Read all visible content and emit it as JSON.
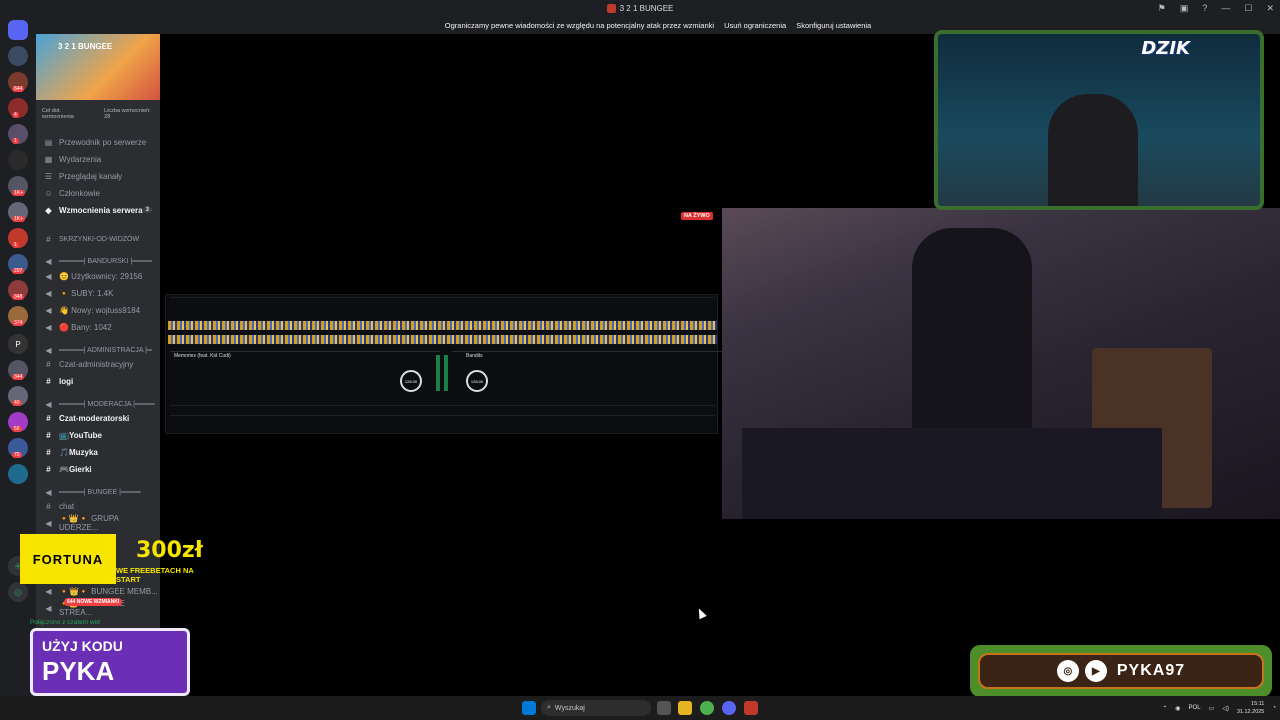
{
  "window": {
    "title": "3 2 1 BUNGEE"
  },
  "banner": {
    "message": "Ograniczamy pewne wiadomości ze względu na potencjalny atak przez wzmianki",
    "action1": "Usuń ograniczenia",
    "action2": "Skonfiguruj ustawienia"
  },
  "server": {
    "name": "3 2 1 BUNGEE",
    "boost_goal_label": "Cel dot. wzmocnienia",
    "boost_count_label": "Liczba wzmocnień: 28"
  },
  "server_badges": [
    "644",
    "4",
    "1",
    "1K+",
    "1K+",
    "1",
    "297",
    "348",
    "374",
    "344",
    "40",
    "56",
    "70"
  ],
  "sidebar": {
    "nav": [
      {
        "icon": "book-icon",
        "label": "Przewodnik po serwerze"
      },
      {
        "icon": "calendar-icon",
        "label": "Wydarzenia"
      },
      {
        "icon": "browse-icon",
        "label": "Przeglądaj kanały"
      },
      {
        "icon": "members-icon",
        "label": "Członkowie"
      },
      {
        "icon": "boost-icon",
        "label": "Wzmocnienia serwera",
        "count": "3"
      }
    ],
    "channels": [
      {
        "icon": "#",
        "label": "SKRZYNKI-OD-WIDZÓW",
        "type": "category"
      },
      {
        "icon": "voice",
        "label": "═════| BANDURSKI |════"
      },
      {
        "icon": "voice",
        "label": "😊 Użytkownicy: 29156"
      },
      {
        "icon": "voice",
        "label": "🔸 SUBY: 1.4K"
      },
      {
        "icon": "voice",
        "label": "👋 Nowy: wojtuss9184"
      },
      {
        "icon": "voice",
        "label": "🔴 Bany: 1042"
      },
      {
        "icon": "voice",
        "label": "═════| ADMINISTRACJA |═"
      },
      {
        "icon": "#",
        "label": "Czat-administracyjny"
      },
      {
        "icon": "#",
        "label": "logi",
        "bold": true
      },
      {
        "icon": "voice",
        "label": "═════| MODERACJA |════"
      },
      {
        "icon": "#",
        "label": "Czat-moderatorski",
        "bold": true
      },
      {
        "icon": "#",
        "label": "📺YouTube",
        "bold": true
      },
      {
        "icon": "#",
        "label": "🎵Muzyka",
        "bold": true
      },
      {
        "icon": "#",
        "label": "🎮Gierki",
        "bold": true
      },
      {
        "icon": "voice",
        "label": "═════| BUNGEE |════"
      },
      {
        "icon": "#",
        "label": "chat"
      },
      {
        "icon": "voice",
        "label": "🔸👑🔸 GRUPA UDERZE..."
      }
    ],
    "hidden_items": [
      "🔸👑🔸 BUNGEE MEMB...",
      "🔸👑🔸 BUNGEE STREA..."
    ],
    "mentions_badge": "644 NOWE WZMIANKI",
    "connection_status": "Połączono z czatem wid"
  },
  "dj": {
    "deck_a_title": "Memories (feat. Kid Cudi)",
    "deck_b_title": "Bandits",
    "bpm_a": "128.00",
    "bpm_b": "128.00"
  },
  "stream": {
    "live_badge": "NA ŻYWO"
  },
  "overlay": {
    "brand": "DZIK",
    "fortuna_name": "FORTUNA",
    "fortuna_amount": "300zł",
    "fortuna_sub": "WE FREEBETACH NA START",
    "code_line1": "UŻYJ KODU",
    "code_line2": "PYKA",
    "social_handle": "PYKA97"
  },
  "taskbar": {
    "search_placeholder": "Wyszukaj",
    "lang": "POL",
    "time": "15:11",
    "date": "31.12.2025"
  }
}
